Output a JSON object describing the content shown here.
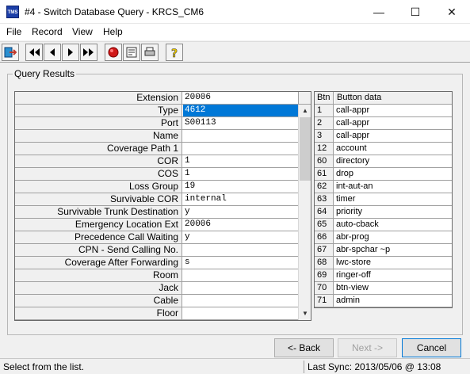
{
  "window": {
    "title": "#4 - Switch Database Query - KRCS_CM6",
    "app_icon_text": "TMS",
    "minimize": "—",
    "maximize": "☐",
    "close": "✕"
  },
  "menu": {
    "items": [
      {
        "label": "File"
      },
      {
        "label": "Record"
      },
      {
        "label": "View"
      },
      {
        "label": "Help"
      }
    ]
  },
  "toolbar": {
    "buttons": [
      {
        "icon": "exit-icon"
      },
      {
        "icon": "first-record-icon"
      },
      {
        "icon": "previous-record-icon"
      },
      {
        "icon": "next-record-icon"
      },
      {
        "icon": "last-record-icon"
      },
      {
        "icon": "query-icon"
      },
      {
        "icon": "properties-icon"
      },
      {
        "icon": "print-icon"
      },
      {
        "icon": "help-icon"
      }
    ]
  },
  "query_results": {
    "label": "Query Results",
    "rows": [
      {
        "label": "Extension",
        "value": "20006"
      },
      {
        "label": "Type",
        "value": "4612"
      },
      {
        "label": "Port",
        "value": "S00113"
      },
      {
        "label": "Name",
        "value": ""
      },
      {
        "label": "Coverage Path 1",
        "value": ""
      },
      {
        "label": "COR",
        "value": "1"
      },
      {
        "label": "COS",
        "value": "1"
      },
      {
        "label": "Loss Group",
        "value": "19"
      },
      {
        "label": "Survivable COR",
        "value": "internal"
      },
      {
        "label": "Survivable Trunk Destination",
        "value": "y"
      },
      {
        "label": "Emergency Location Ext",
        "value": "20006"
      },
      {
        "label": "Precedence Call Waiting",
        "value": "y"
      },
      {
        "label": "CPN - Send Calling No.",
        "value": ""
      },
      {
        "label": "Coverage After Forwarding",
        "value": "s"
      },
      {
        "label": "Room",
        "value": ""
      },
      {
        "label": "Jack",
        "value": ""
      },
      {
        "label": "Cable",
        "value": ""
      },
      {
        "label": "Floor",
        "value": ""
      }
    ],
    "selected_index": 1
  },
  "button_data": {
    "headers": {
      "btn": "Btn",
      "data": "Button data"
    },
    "rows": [
      {
        "btn": "1",
        "data": "call-appr"
      },
      {
        "btn": "2",
        "data": "call-appr"
      },
      {
        "btn": "3",
        "data": "call-appr"
      },
      {
        "btn": "12",
        "data": "account"
      },
      {
        "btn": "60",
        "data": "directory"
      },
      {
        "btn": "61",
        "data": "drop"
      },
      {
        "btn": "62",
        "data": "int-aut-an"
      },
      {
        "btn": "63",
        "data": "timer"
      },
      {
        "btn": "64",
        "data": "priority"
      },
      {
        "btn": "65",
        "data": "auto-cback"
      },
      {
        "btn": "66",
        "data": "abr-prog"
      },
      {
        "btn": "67",
        "data": "abr-spchar  ~p"
      },
      {
        "btn": "68",
        "data": "lwc-store"
      },
      {
        "btn": "69",
        "data": "ringer-off"
      },
      {
        "btn": "70",
        "data": "btn-view"
      },
      {
        "btn": "71",
        "data": "admin"
      }
    ]
  },
  "buttons": {
    "back": "<- Back",
    "next": "Next ->",
    "cancel": "Cancel"
  },
  "status": {
    "message": "Select from the list.",
    "last_sync": "Last Sync: 2013/05/06  @  13:08"
  },
  "colors": {
    "selection": "#0078d7",
    "background": "#f0f0f0"
  }
}
